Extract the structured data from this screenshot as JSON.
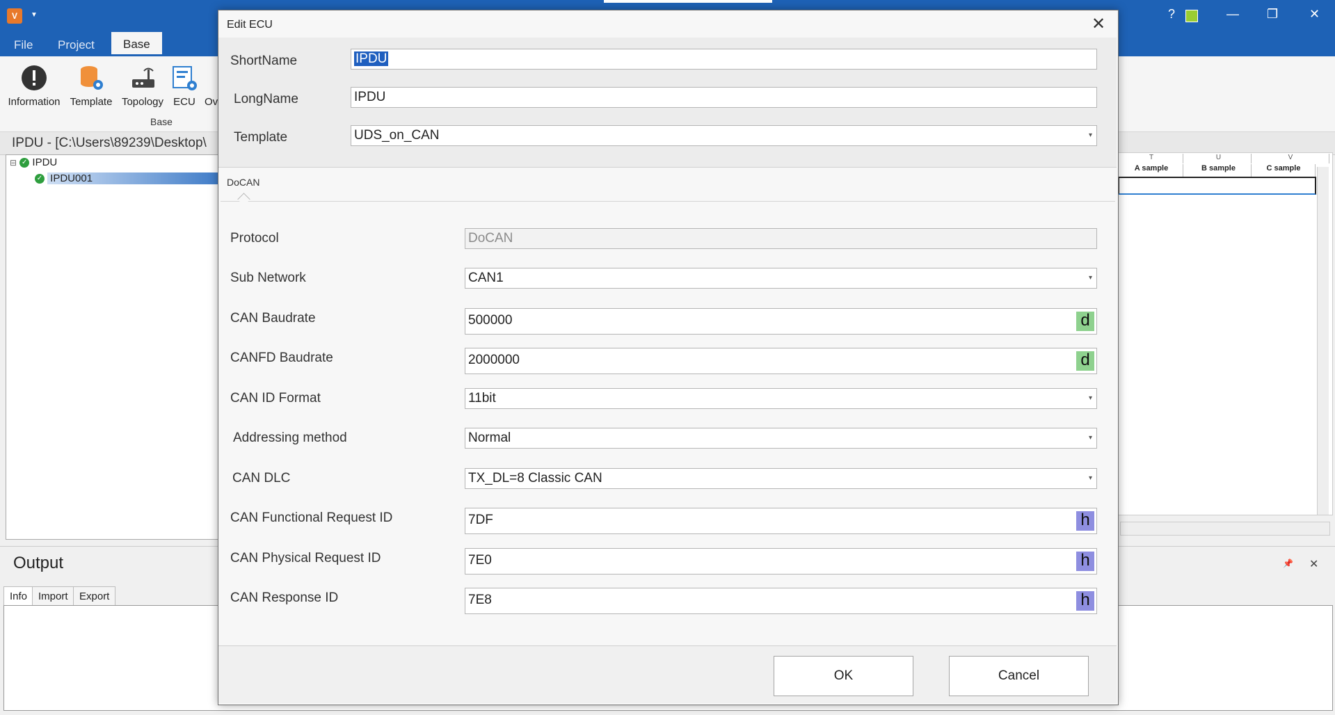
{
  "app": {
    "logo_text": "V",
    "tabs": [
      "File",
      "Project",
      "Base"
    ],
    "active_tab": "Base",
    "ribbon": {
      "buttons": [
        "Information",
        "Template",
        "Topology",
        "ECU",
        "Ov"
      ],
      "group_label": "Base"
    },
    "window_buttons": {
      "help": "?",
      "minimize": "—",
      "restore": "❐",
      "close": "✕"
    },
    "path": "IPDU - [C:\\Users\\89239\\Desktop\\",
    "tree": [
      {
        "label": "IPDU",
        "expander": "⊟"
      },
      {
        "label": "IPDU001"
      }
    ],
    "grid": {
      "column_letters": [
        "T",
        "U",
        "V"
      ],
      "column_names": [
        "A sample",
        "B sample",
        "C sample"
      ]
    },
    "output": {
      "title": "Output",
      "tabs": [
        "Info",
        "Import",
        "Export"
      ],
      "pin": "📌",
      "close": "✕"
    }
  },
  "dialog": {
    "title": "Edit ECU",
    "close_icon": "✕",
    "fields": {
      "shortname": {
        "label": "ShortName",
        "value": "IPDU"
      },
      "longname": {
        "label": "LongName",
        "value": "IPDU"
      },
      "template": {
        "label": "Template",
        "value": "UDS_on_CAN"
      }
    },
    "tab_label": "DoCAN",
    "protocol_fields": [
      {
        "label": "Protocol",
        "value": "DoCAN",
        "kind": "readonly"
      },
      {
        "label": "Sub Network",
        "value": "CAN1",
        "kind": "dropdown"
      },
      {
        "label": "CAN Baudrate",
        "value": "500000",
        "kind": "decimal",
        "badge": "d"
      },
      {
        "label": "CANFD Baudrate",
        "value": "2000000",
        "kind": "decimal",
        "badge": "d"
      },
      {
        "label": "CAN ID Format",
        "value": "11bit",
        "kind": "dropdown"
      },
      {
        "label": "Addressing method",
        "value": "Normal",
        "kind": "dropdown"
      },
      {
        "label": "CAN DLC",
        "value": "TX_DL=8 Classic CAN",
        "kind": "dropdown"
      },
      {
        "label": "CAN Functional Request ID",
        "value": "7DF",
        "kind": "hex",
        "badge": "h"
      },
      {
        "label": "CAN Physical Request ID",
        "value": "7E0",
        "kind": "hex",
        "badge": "h"
      },
      {
        "label": "CAN Response ID",
        "value": "7E8",
        "kind": "hex",
        "badge": "h"
      }
    ],
    "ok_label": "OK",
    "cancel_label": "Cancel"
  },
  "colors": {
    "title_bar": "#1e62b6",
    "selection": "#1f5fbf",
    "decimal_badge": "#8ed18e",
    "hex_badge": "#8e8ee0",
    "status_ok": "#2e9e3e"
  }
}
